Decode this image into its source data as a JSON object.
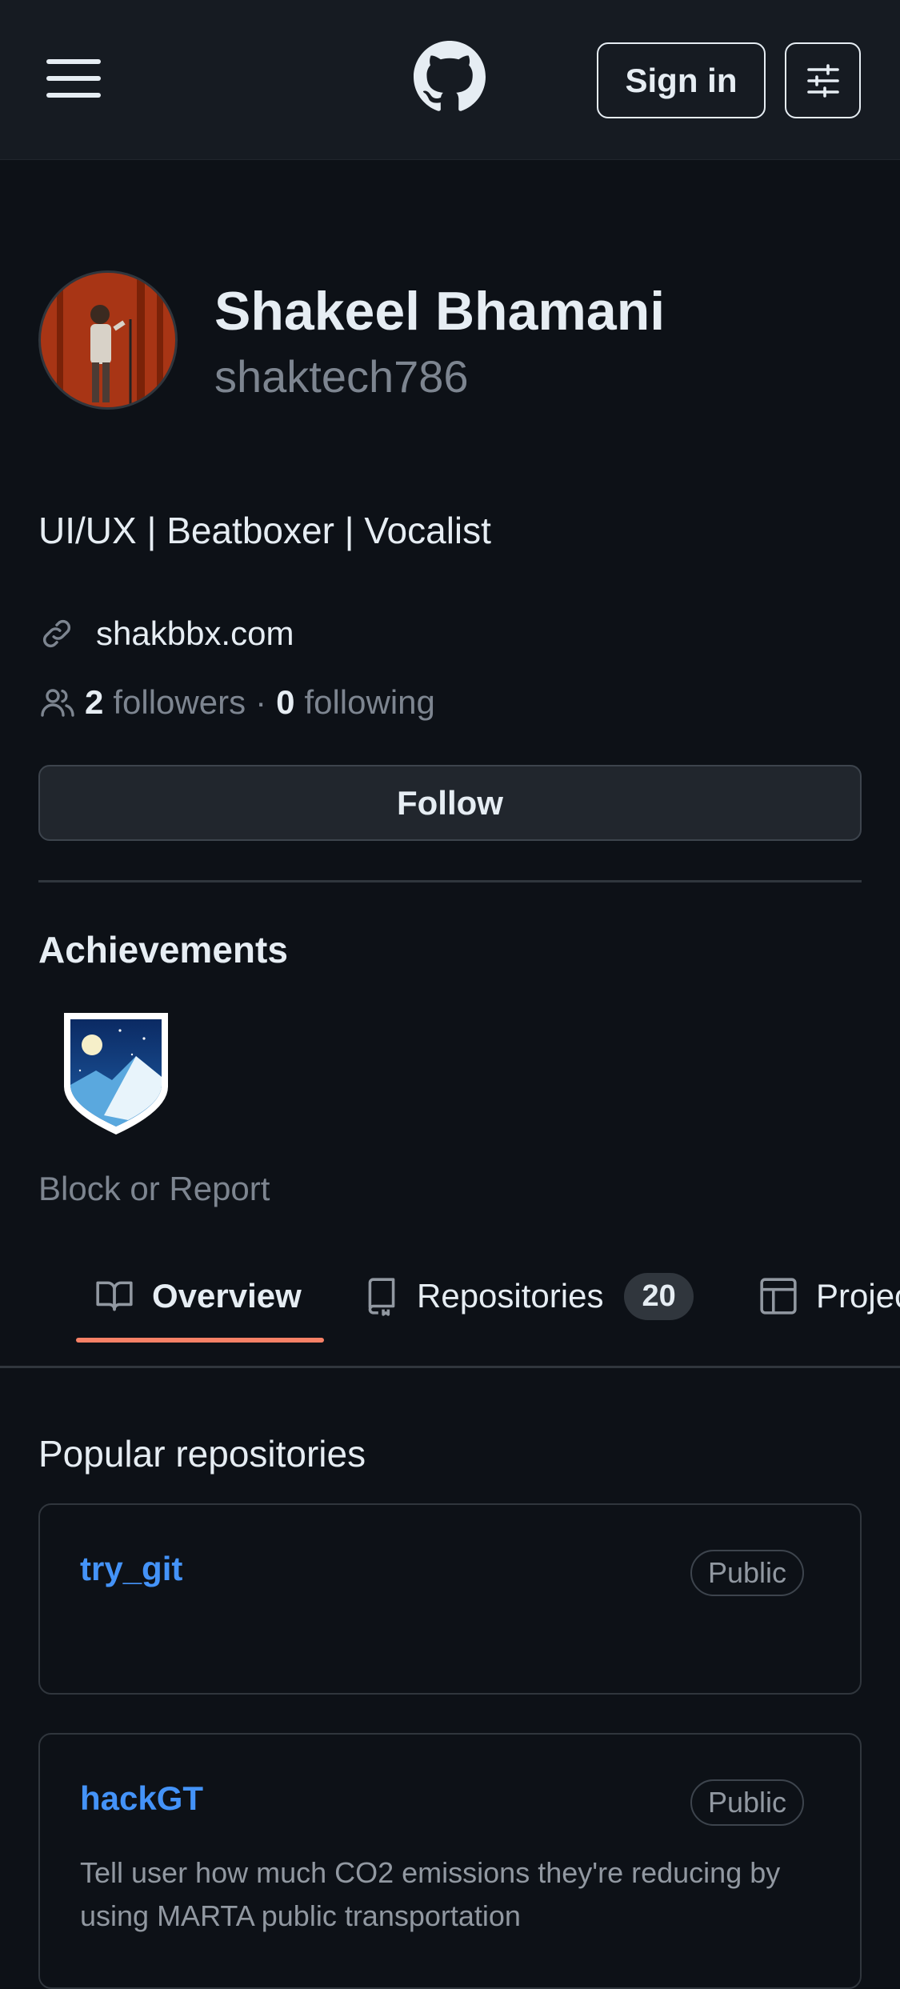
{
  "header": {
    "menu_icon": "hamburger-menu-icon",
    "logo_icon": "github-octocat-icon",
    "signin_label": "Sign in",
    "settings_icon": "sliders-icon"
  },
  "profile": {
    "name": "Shakeel Bhamani",
    "username": "shaktech786",
    "bio": "UI/UX | Beatboxer | Vocalist",
    "website": "shakbbx.com",
    "followers_count": "2",
    "followers_label": "followers",
    "separator": "·",
    "following_count": "0",
    "following_label": "following",
    "follow_label": "Follow"
  },
  "achievements": {
    "title": "Achievements",
    "badge_icon": "arctic-code-vault-badge-icon"
  },
  "block_report": "Block or Report",
  "tabs": [
    {
      "label": "Overview",
      "icon": "book-icon"
    },
    {
      "label": "Repositories",
      "icon": "repo-icon",
      "count": "20"
    },
    {
      "label": "Projects",
      "icon": "table-icon"
    }
  ],
  "popular": {
    "title": "Popular repositories",
    "repos": [
      {
        "name": "try_git",
        "visibility": "Public",
        "description": ""
      },
      {
        "name": "hackGT",
        "visibility": "Public",
        "description": "Tell user how much CO2 emissions they're reducing by using MARTA public transportation"
      }
    ]
  },
  "colors": {
    "background": "#0d1117",
    "header": "#161b22",
    "link": "#4493f8",
    "muted": "#7d8590",
    "tab_accent": "#f78166"
  }
}
